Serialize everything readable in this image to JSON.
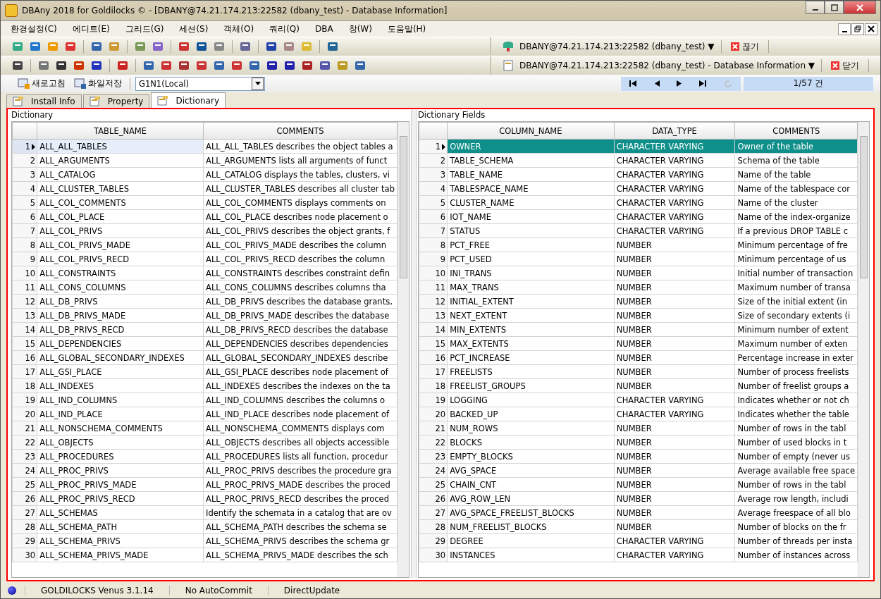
{
  "window": {
    "title": "DBAny 2018 for Goldilocks © - [DBANY@74.21.174.213:22582 (dbany_test) - Database Information]"
  },
  "menu": [
    "환경설정(C)",
    "에디트(E)",
    "그리드(G)",
    "세션(S)",
    "객체(O)",
    "쿼리(Q)",
    "DBA",
    "창(W)",
    "도움말(H)"
  ],
  "connection": {
    "label": "DBANY@74.21.174.213:22582 (dbany_test) ▼",
    "disconnect": "끊기"
  },
  "window_switch": {
    "label": "DBANY@74.21.174.213:22582 (dbany_test) - Database Information ▼",
    "close": "닫기"
  },
  "actions": {
    "refresh": "새로고침",
    "save_file": "화일저장",
    "node": "G1N1(Local)"
  },
  "record_count": "1/57 건",
  "tabs": [
    {
      "label": "Install Info",
      "selected": false
    },
    {
      "label": "Property",
      "selected": false
    },
    {
      "label": "Dictionary",
      "selected": true
    }
  ],
  "dictionary": {
    "title": "Dictionary",
    "columns": [
      "TABLE_NAME",
      "COMMENTS"
    ],
    "rows": [
      {
        "num": "1",
        "cells": [
          "ALL_ALL_TABLES",
          "ALL_ALL_TABLES describes the object tables a"
        ],
        "selected": true
      },
      {
        "num": "2",
        "cells": [
          "ALL_ARGUMENTS",
          "ALL_ARGUMENTS lists all arguments of funct"
        ],
        "selected": false
      },
      {
        "num": "3",
        "cells": [
          "ALL_CATALOG",
          "ALL_CATALOG displays the tables, clusters, vi"
        ],
        "selected": false
      },
      {
        "num": "4",
        "cells": [
          "ALL_CLUSTER_TABLES",
          "ALL_CLUSTER_TABLES describes all cluster tab"
        ],
        "selected": false
      },
      {
        "num": "5",
        "cells": [
          "ALL_COL_COMMENTS",
          "ALL_COL_COMMENTS displays comments on"
        ],
        "selected": false
      },
      {
        "num": "6",
        "cells": [
          "ALL_COL_PLACE",
          "ALL_COL_PLACE describes node placement o"
        ],
        "selected": false
      },
      {
        "num": "7",
        "cells": [
          "ALL_COL_PRIVS",
          "ALL_COL_PRIVS describes the object grants, f"
        ],
        "selected": false
      },
      {
        "num": "8",
        "cells": [
          "ALL_COL_PRIVS_MADE",
          "ALL_COL_PRIVS_MADE describes the column"
        ],
        "selected": false
      },
      {
        "num": "9",
        "cells": [
          "ALL_COL_PRIVS_RECD",
          "ALL_COL_PRIVS_RECD describes the column"
        ],
        "selected": false
      },
      {
        "num": "10",
        "cells": [
          "ALL_CONSTRAINTS",
          "ALL_CONSTRAINTS describes constraint defin"
        ],
        "selected": false
      },
      {
        "num": "11",
        "cells": [
          "ALL_CONS_COLUMNS",
          "ALL_CONS_COLUMNS describes columns tha"
        ],
        "selected": false
      },
      {
        "num": "12",
        "cells": [
          "ALL_DB_PRIVS",
          "ALL_DB_PRIVS describes the database grants,"
        ],
        "selected": false
      },
      {
        "num": "13",
        "cells": [
          "ALL_DB_PRIVS_MADE",
          "ALL_DB_PRIVS_MADE describes the database"
        ],
        "selected": false
      },
      {
        "num": "14",
        "cells": [
          "ALL_DB_PRIVS_RECD",
          "ALL_DB_PRIVS_RECD describes the database"
        ],
        "selected": false
      },
      {
        "num": "15",
        "cells": [
          "ALL_DEPENDENCIES",
          "ALL_DEPENDENCIES describes dependencies"
        ],
        "selected": false
      },
      {
        "num": "16",
        "cells": [
          "ALL_GLOBAL_SECONDARY_INDEXES",
          "ALL_GLOBAL_SECONDARY_INDEXES describe"
        ],
        "selected": false
      },
      {
        "num": "17",
        "cells": [
          "ALL_GSI_PLACE",
          "ALL_GSI_PLACE describes node placement of"
        ],
        "selected": false
      },
      {
        "num": "18",
        "cells": [
          "ALL_INDEXES",
          "ALL_INDEXES describes the indexes on the ta"
        ],
        "selected": false
      },
      {
        "num": "19",
        "cells": [
          "ALL_IND_COLUMNS",
          "ALL_IND_COLUMNS describes the columns o"
        ],
        "selected": false
      },
      {
        "num": "20",
        "cells": [
          "ALL_IND_PLACE",
          "ALL_IND_PLACE describes node placement of"
        ],
        "selected": false
      },
      {
        "num": "21",
        "cells": [
          "ALL_NONSCHEMA_COMMENTS",
          "ALL_NONSCHEMA_COMMENTS displays com"
        ],
        "selected": false
      },
      {
        "num": "22",
        "cells": [
          "ALL_OBJECTS",
          "ALL_OBJECTS describes all objects accessible"
        ],
        "selected": false
      },
      {
        "num": "23",
        "cells": [
          "ALL_PROCEDURES",
          "ALL_PROCEDURES lists all function, procedur"
        ],
        "selected": false
      },
      {
        "num": "24",
        "cells": [
          "ALL_PROC_PRIVS",
          "ALL_PROC_PRIVS describes the procedure gra"
        ],
        "selected": false
      },
      {
        "num": "25",
        "cells": [
          "ALL_PROC_PRIVS_MADE",
          "ALL_PROC_PRIVS_MADE describes the proced"
        ],
        "selected": false
      },
      {
        "num": "26",
        "cells": [
          "ALL_PROC_PRIVS_RECD",
          "ALL_PROC_PRIVS_RECD describes the proced"
        ],
        "selected": false
      },
      {
        "num": "27",
        "cells": [
          "ALL_SCHEMAS",
          "Identify the schemata in a catalog that are ov"
        ],
        "selected": false
      },
      {
        "num": "28",
        "cells": [
          "ALL_SCHEMA_PATH",
          "ALL_SCHEMA_PATH describes the schema se"
        ],
        "selected": false
      },
      {
        "num": "29",
        "cells": [
          "ALL_SCHEMA_PRIVS",
          "ALL_SCHEMA_PRIVS describes the schema gr"
        ],
        "selected": false
      },
      {
        "num": "30",
        "cells": [
          "ALL_SCHEMA_PRIVS_MADE",
          "ALL_SCHEMA_PRIVS_MADE describes the sch"
        ],
        "selected": false
      }
    ]
  },
  "dictionary_fields": {
    "title": "Dictionary Fields",
    "columns": [
      "COLUMN_NAME",
      "DATA_TYPE",
      "COMMENTS"
    ],
    "rows": [
      {
        "num": "1",
        "cells": [
          "OWNER",
          "CHARACTER VARYING",
          "Owner of the table"
        ],
        "selected": true
      },
      {
        "num": "2",
        "cells": [
          "TABLE_SCHEMA",
          "CHARACTER VARYING",
          "Schema of the table"
        ],
        "selected": false
      },
      {
        "num": "3",
        "cells": [
          "TABLE_NAME",
          "CHARACTER VARYING",
          "Name of the table"
        ],
        "selected": false
      },
      {
        "num": "4",
        "cells": [
          "TABLESPACE_NAME",
          "CHARACTER VARYING",
          "Name of the tablespace cor"
        ],
        "selected": false
      },
      {
        "num": "5",
        "cells": [
          "CLUSTER_NAME",
          "CHARACTER VARYING",
          "Name of the cluster"
        ],
        "selected": false
      },
      {
        "num": "6",
        "cells": [
          "IOT_NAME",
          "CHARACTER VARYING",
          "Name of the index-organize"
        ],
        "selected": false
      },
      {
        "num": "7",
        "cells": [
          "STATUS",
          "CHARACTER VARYING",
          "If a previous DROP TABLE c"
        ],
        "selected": false
      },
      {
        "num": "8",
        "cells": [
          "PCT_FREE",
          "NUMBER",
          "Minimum percentage of fre"
        ],
        "selected": false
      },
      {
        "num": "9",
        "cells": [
          "PCT_USED",
          "NUMBER",
          "Minimum percentage of us"
        ],
        "selected": false
      },
      {
        "num": "10",
        "cells": [
          "INI_TRANS",
          "NUMBER",
          "Initial number of transaction"
        ],
        "selected": false
      },
      {
        "num": "11",
        "cells": [
          "MAX_TRANS",
          "NUMBER",
          "Maximum number of transa"
        ],
        "selected": false
      },
      {
        "num": "12",
        "cells": [
          "INITIAL_EXTENT",
          "NUMBER",
          "Size of the initial extent (in"
        ],
        "selected": false
      },
      {
        "num": "13",
        "cells": [
          "NEXT_EXTENT",
          "NUMBER",
          "Size of secondary extents (i"
        ],
        "selected": false
      },
      {
        "num": "14",
        "cells": [
          "MIN_EXTENTS",
          "NUMBER",
          "Minimum number of extent"
        ],
        "selected": false
      },
      {
        "num": "15",
        "cells": [
          "MAX_EXTENTS",
          "NUMBER",
          "Maximum number of exten"
        ],
        "selected": false
      },
      {
        "num": "16",
        "cells": [
          "PCT_INCREASE",
          "NUMBER",
          "Percentage increase in exter"
        ],
        "selected": false
      },
      {
        "num": "17",
        "cells": [
          "FREELISTS",
          "NUMBER",
          "Number of process freelists"
        ],
        "selected": false
      },
      {
        "num": "18",
        "cells": [
          "FREELIST_GROUPS",
          "NUMBER",
          "Number of freelist groups a"
        ],
        "selected": false
      },
      {
        "num": "19",
        "cells": [
          "LOGGING",
          "CHARACTER VARYING",
          "Indicates whether or not ch"
        ],
        "selected": false
      },
      {
        "num": "20",
        "cells": [
          "BACKED_UP",
          "CHARACTER VARYING",
          "Indicates whether the table"
        ],
        "selected": false
      },
      {
        "num": "21",
        "cells": [
          "NUM_ROWS",
          "NUMBER",
          "Number of rows in the tabl"
        ],
        "selected": false
      },
      {
        "num": "22",
        "cells": [
          "BLOCKS",
          "NUMBER",
          "Number of used blocks in t"
        ],
        "selected": false
      },
      {
        "num": "23",
        "cells": [
          "EMPTY_BLOCKS",
          "NUMBER",
          "Number of empty (never us"
        ],
        "selected": false
      },
      {
        "num": "24",
        "cells": [
          "AVG_SPACE",
          "NUMBER",
          "Average available free space"
        ],
        "selected": false
      },
      {
        "num": "25",
        "cells": [
          "CHAIN_CNT",
          "NUMBER",
          "Number of rows in the tabl"
        ],
        "selected": false
      },
      {
        "num": "26",
        "cells": [
          "AVG_ROW_LEN",
          "NUMBER",
          "Average row length, includi"
        ],
        "selected": false
      },
      {
        "num": "27",
        "cells": [
          "AVG_SPACE_FREELIST_BLOCKS",
          "NUMBER",
          "Average freespace of all blo"
        ],
        "selected": false
      },
      {
        "num": "28",
        "cells": [
          "NUM_FREELIST_BLOCKS",
          "NUMBER",
          "Number of blocks on the fr"
        ],
        "selected": false
      },
      {
        "num": "29",
        "cells": [
          "DEGREE",
          "CHARACTER VARYING",
          "Number of threads per insta"
        ],
        "selected": false
      },
      {
        "num": "30",
        "cells": [
          "INSTANCES",
          "CHARACTER VARYING",
          "Number of instances across"
        ],
        "selected": false
      }
    ]
  },
  "status_bar": [
    "GOLDILOCKS Venus 3.1.14",
    "No AutoCommit",
    "DirectUpdate"
  ]
}
